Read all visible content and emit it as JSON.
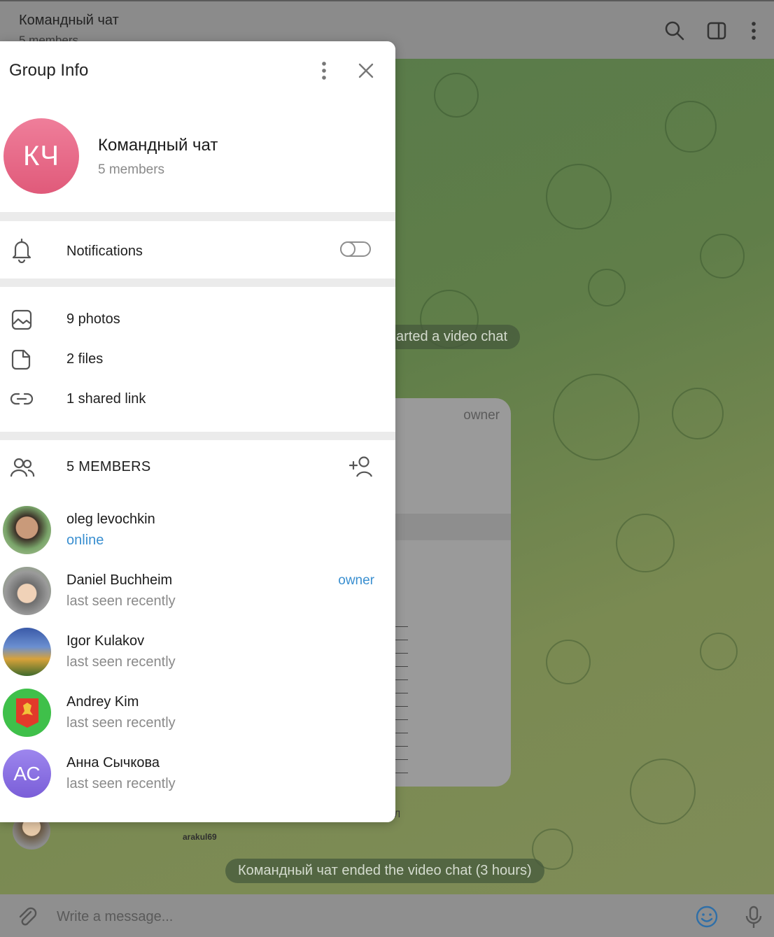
{
  "chat": {
    "title": "Командный чат",
    "subtitle": "5 members",
    "service_started": "arted a video chat",
    "service_ended": "Командный чат ended the video chat (3 hours)",
    "bubble_owner": "owner",
    "bubble_sender": "arakul69",
    "bubble_tail": "Л",
    "composer_placeholder": "Write a message..."
  },
  "group_info": {
    "title": "Group Info",
    "avatar_initials": "КЧ",
    "name": "Командный чат",
    "members_count": "5 members",
    "notifications": {
      "label": "Notifications",
      "enabled": false
    },
    "media": [
      {
        "icon": "photo-icon",
        "label": "9 photos"
      },
      {
        "icon": "file-icon",
        "label": "2 files"
      },
      {
        "icon": "link-icon",
        "label": "1 shared link"
      }
    ],
    "members_header": "5 MEMBERS",
    "members": [
      {
        "name": "oleg levochkin",
        "status": "online",
        "online": true,
        "owner_tag": ""
      },
      {
        "name": "Daniel Buchheim",
        "status": "last seen recently",
        "online": false,
        "owner_tag": "owner"
      },
      {
        "name": "Igor Kulakov",
        "status": "last seen recently",
        "online": false,
        "owner_tag": ""
      },
      {
        "name": "Andrey Kim",
        "status": "last seen recently",
        "online": false,
        "owner_tag": ""
      },
      {
        "name": "Анна Сычкова",
        "status": "last seen recently",
        "online": false,
        "owner_tag": "",
        "initials": "АС"
      }
    ]
  },
  "colors": {
    "accent": "#3a8fd0",
    "group_avatar": "#e86a88",
    "member_avatar_purple": "#8a6fe0"
  }
}
